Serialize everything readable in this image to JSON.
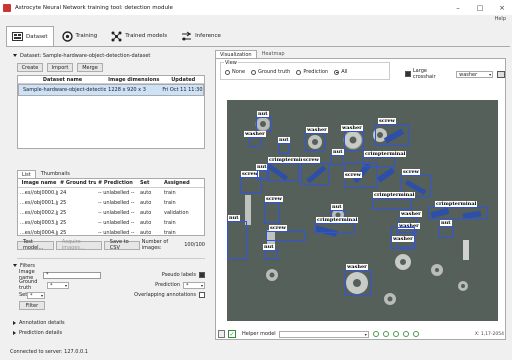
{
  "window": {
    "title": "Astrocyte Neural Network training tool: detection module",
    "help": "Help"
  },
  "tabs": [
    {
      "label": "Dataset",
      "icon": "dataset-icon"
    },
    {
      "label": "Training",
      "icon": "training-icon"
    },
    {
      "label": "Trained models",
      "icon": "trained-models-icon"
    },
    {
      "label": "Inference",
      "icon": "inference-icon"
    }
  ],
  "dataset": {
    "header": "Dataset: Sample-hardware-object-detection-dataset",
    "buttons": {
      "create": "Create",
      "import": "Import",
      "merge": "Merge"
    },
    "columns": [
      "Dataset name",
      "Image dimensions",
      "Updated"
    ],
    "row": [
      "Sample-hardware-object-detection-dataset",
      "1228 x 920 x 3",
      "Fri Oct 11 11:30:17 2024"
    ]
  },
  "list": {
    "tabs": [
      "List",
      "Thumbnails"
    ],
    "columns": [
      "Image name",
      "# Ground truth",
      "# Prediction",
      "Set",
      "Assigned"
    ],
    "rows": [
      [
        "...es//obj0000.jpg",
        "24",
        "-- unlabelled --",
        "auto",
        "train"
      ],
      [
        "...es//obj0001.jpg",
        "25",
        "-- unlabelled --",
        "auto",
        "train"
      ],
      [
        "...es//obj0002.jpg",
        "25",
        "-- unlabelled --",
        "auto",
        "validation"
      ],
      [
        "...es//obj0003.jpg",
        "25",
        "-- unlabelled --",
        "auto",
        "train"
      ],
      [
        "...es//obj0004.jpg",
        "25",
        "-- unlabelled --",
        "auto",
        "train"
      ]
    ],
    "buttons": {
      "test": "Test model...",
      "acquire": "Acquire images...",
      "save": "Save to CSV"
    },
    "count_label": "Number of images:",
    "count_value": "100/100"
  },
  "filters": {
    "header": "Filters",
    "image_name_label": "Image name",
    "image_name_value": "*",
    "pseudo_labels": "Pseudo labels",
    "ground_truth_label": "Ground truth",
    "ground_truth_value": "*",
    "prediction_label": "Prediction",
    "prediction_value": "*",
    "set_label": "Set",
    "set_value": "*",
    "overlapping": "Overlapping annotations",
    "filter_btn": "Filter"
  },
  "sections": {
    "annotation": "Annotation details",
    "prediction": "Prediction details"
  },
  "viewer": {
    "tabs": [
      "Visualization",
      "Heatmap"
    ],
    "view_label": "View",
    "view_options": [
      "None",
      "Ground truth",
      "Prediction",
      "All"
    ],
    "crosshair": "Large crosshair",
    "crosshair_color": "washer",
    "helper_label": "Helper model",
    "coords": "X: 1,17-2054"
  },
  "detections": [
    {
      "label": "nut"
    },
    {
      "label": "washer"
    },
    {
      "label": "washer"
    },
    {
      "label": "screw"
    },
    {
      "label": "washer"
    },
    {
      "label": "nut"
    },
    {
      "label": "screw"
    },
    {
      "label": "nut"
    },
    {
      "label": "crimpterminal"
    },
    {
      "label": "crimpterminal"
    },
    {
      "label": "screw"
    },
    {
      "label": "nut"
    },
    {
      "label": "screw"
    },
    {
      "label": "screw"
    },
    {
      "label": "crimpterminal"
    },
    {
      "label": "nut"
    },
    {
      "label": "screw"
    },
    {
      "label": "crimpterminal"
    },
    {
      "label": "crimpterminal"
    },
    {
      "label": "washer"
    },
    {
      "label": "nut"
    },
    {
      "label": "nut"
    },
    {
      "label": "screw"
    },
    {
      "label": "washer"
    },
    {
      "label": "nut"
    },
    {
      "label": "washer"
    },
    {
      "label": "washer"
    }
  ],
  "status": "Connected to server: 127.0.0.1",
  "colors": {
    "box": "#2f55e0",
    "accent": "#0078d7"
  }
}
